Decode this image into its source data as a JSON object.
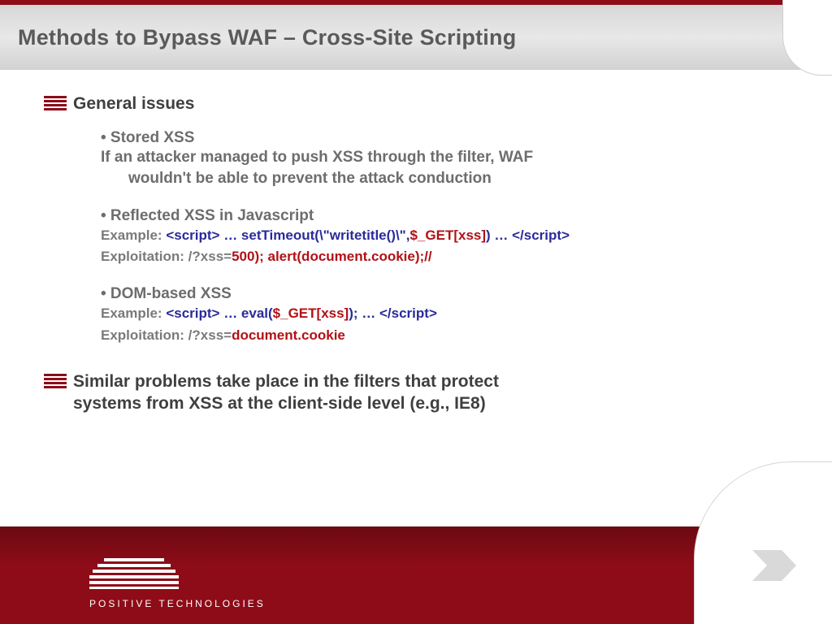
{
  "slide": {
    "title": "Methods to Bypass WAF – Cross-Site Scripting"
  },
  "content": {
    "heading1": "General issues",
    "stored": {
      "title": "• Stored XSS",
      "line1": "If an attacker managed to push XSS through the filter, WAF",
      "line2": "wouldn't be able to prevent the attack conduction"
    },
    "reflected": {
      "title": "• Reflected XSS in Javascript",
      "ex_label": "Example: ",
      "ex_open": "<script> ",
      "ex_mid": "… setTimeout(\\\"writetitle()\\\",",
      "ex_var": "$_ GET[xss]",
      "ex_mid2": ") … ",
      "ex_close": "</scri pt>",
      "exp_label": "Exploitation: ",
      "exp_pre": "/?xss=",
      "exp_payload": "500); alert(document.cookie);//"
    },
    "dom": {
      "title": "• DOM-based XSS",
      "ex_label": "Example: ",
      "ex_open": "<script> ",
      "ex_mid": "… eval(",
      "ex_var": "$_ GET[xss]",
      "ex_mid2": "); … ",
      "ex_close": "</scri pt>",
      "exp_label": "Exploitation: ",
      "exp_pre": "/?xss=",
      "exp_payload": "document.cookie"
    },
    "heading2a": "Similar problems take place in the filters that protect",
    "heading2b": "systems from XSS at the client-side level (e.g., IE8)"
  },
  "footer": {
    "brand": "POSITIVE  TECHNOLOGIES"
  },
  "colors": {
    "accent": "#8d0c18",
    "code_tag": "#2a2b9a",
    "code_red": "#b11116"
  }
}
